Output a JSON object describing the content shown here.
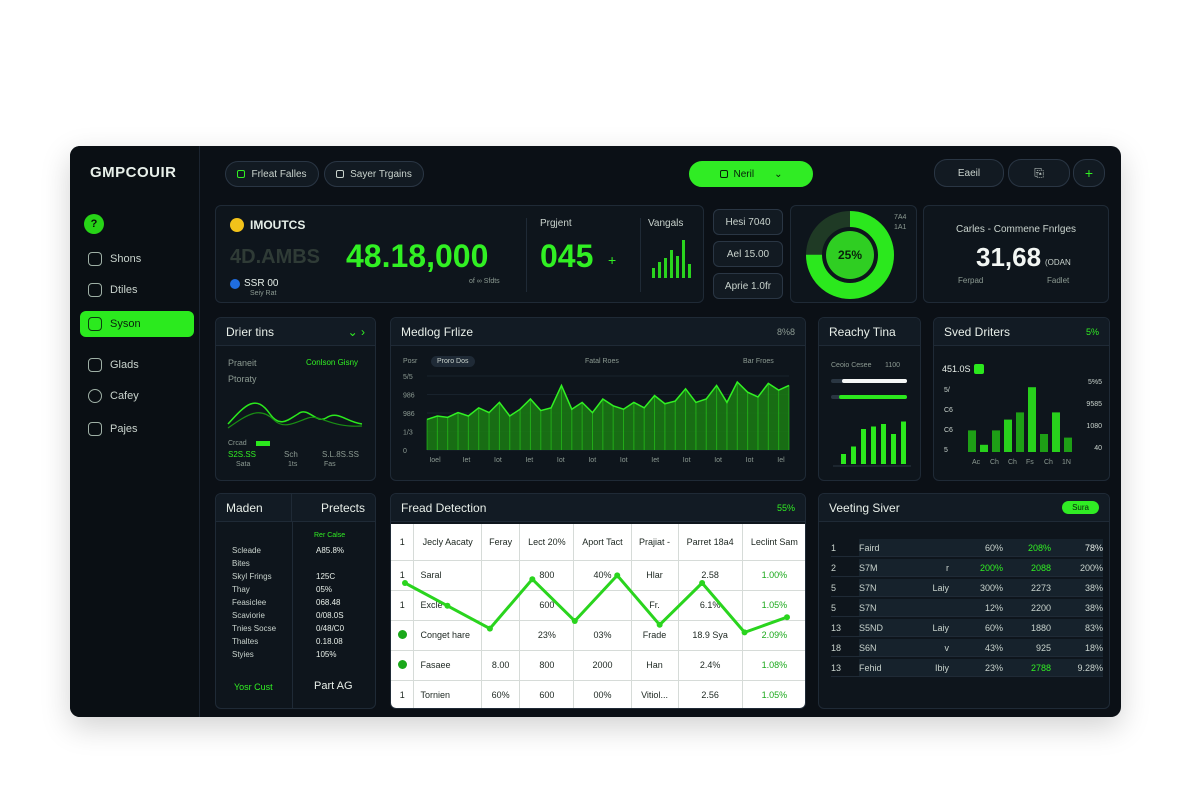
{
  "app": {
    "logo_a": "GMPCOUI",
    "logo_b": "R",
    "logo_badge": "?"
  },
  "sidebar": {
    "items": [
      {
        "label": "Shons",
        "icon": "cloud-icon"
      },
      {
        "label": "Dtiles",
        "icon": "cloud-outline-icon"
      },
      {
        "label": "Syson",
        "icon": "list-icon"
      },
      {
        "label": "Glads",
        "icon": "chart-icon"
      },
      {
        "label": "Cafey",
        "icon": "circle-icon"
      },
      {
        "label": "Pajes",
        "icon": "box-icon"
      }
    ]
  },
  "topbar": {
    "btn1": "Frleat Falles",
    "btn2": "Sayer Trgains",
    "btn3": "Neril",
    "btn4": "Eaeil",
    "btn5_icon": "document-icon",
    "btn6": "+"
  },
  "kpi": {
    "title": "IMOUTCS",
    "ghost": "4D.AMBS",
    "value": "48.18,000",
    "sub_a": "SSR 00",
    "sub_b": "Seiy Rat",
    "sub_c": "of ∞ Sfdts",
    "project_label": "Prgjent",
    "project_value": "045",
    "project_suffix": "+",
    "vang_label": "Vangals"
  },
  "mini_buttons": [
    "Hesi 7040",
    "Ael 15.00",
    "Aprie 1.0fr"
  ],
  "donut": {
    "value_label": "25%",
    "side_a": "7A4",
    "side_b": "1A1",
    "percent": 0.75
  },
  "carles": {
    "title": "Carles - Commene  Fnrlges",
    "value": "31,68",
    "suffix": "(ODAN",
    "sub_a": "Ferpad",
    "sub_b": "Fadlet"
  },
  "drier": {
    "title": "Drier tins",
    "line1": "Praneit",
    "line1_right": "Conlson Gisny",
    "line2": "Ptoraty",
    "legend": "Crcad",
    "stat1": "S2S.SS",
    "stat1_sub": "Sata",
    "stat2": "Sch",
    "stat2_sub": "1ts",
    "stat3": "S.L.8S.SS",
    "stat3_sub": "Fas"
  },
  "medlog": {
    "title": "Medlog Frlize",
    "header_right": "8%8",
    "tag": "Proro Dos",
    "caption1": "Posr",
    "caption2": "Fatal Roes",
    "caption3": "Bar Froes",
    "ytick_labels": [
      "5/5",
      "986",
      "986",
      "1/3",
      "0"
    ],
    "xtick_labels": [
      "Ioel",
      "Iet",
      "Iot",
      "Iet",
      "Iot",
      "Iot",
      "Iot",
      "Iet",
      "Iot",
      "Iot",
      "Iot",
      "Iel"
    ]
  },
  "reachy": {
    "title": "Reachy Tina",
    "row1_left": "Ceoio Cesee",
    "row1_right": "1100",
    "bars_values": [
      20,
      35,
      70,
      75,
      80,
      60,
      85
    ],
    "slider1": 0.85,
    "slider2": 0.9
  },
  "svedd": {
    "title": "Sved Driters",
    "header_right": "5%",
    "highlight": "451.0S",
    "left_ticks": [
      "5/",
      "C6",
      "C6",
      "5"
    ],
    "right_ticks": [
      "5%5",
      "9585",
      "1080",
      "40"
    ],
    "bottom_labels": [
      "Ac",
      "Ch",
      "Ch",
      "Fs",
      "Ch",
      "1N"
    ],
    "bars_values": [
      30,
      10,
      30,
      45,
      55,
      90,
      25,
      55,
      20
    ]
  },
  "maden": {
    "title": "Maden",
    "title2": "Pretects",
    "col2_header": "Rer Calse",
    "rows": [
      {
        "k": "Scleade",
        "v": "A85.8%"
      },
      {
        "k": "Bites",
        "v": ""
      },
      {
        "k": "Skyl Frings",
        "v": "125C"
      },
      {
        "k": "Thay",
        "v": "05%"
      },
      {
        "k": "Feasiclee",
        "v": "068.48"
      },
      {
        "k": "Scaviorie",
        "v": "0/08.0S"
      },
      {
        "k": "Tnies Socse",
        "v": "0/48/C0"
      },
      {
        "k": "Thaltes",
        "v": "0.18.08"
      },
      {
        "k": "Styies",
        "v": "105%"
      }
    ],
    "foot_left": "Yosr Cust",
    "foot_right": "Part AG"
  },
  "fraud": {
    "title": "Fread Detection",
    "header_right": "55%",
    "headers": [
      "1",
      "Jecly Aacaty",
      "Feray",
      "Lect 20%",
      "Aport Tact",
      "Prajiat -",
      "Parret 18a4",
      "Leclint Sam"
    ],
    "rows": [
      [
        "Saral",
        "",
        "800",
        "40%",
        "Hlar",
        "2.58",
        "1.00%"
      ],
      [
        "Excle",
        "",
        "600",
        "",
        "Fr.",
        "6.1%",
        "1.05%"
      ],
      [
        "Conget hare",
        "",
        "23%",
        "03%",
        "Frade",
        "18.9 Sya",
        "2.09%"
      ],
      [
        "Fasaee",
        "8.00",
        "800",
        "2000",
        "Han",
        "2.4%",
        "1.08%"
      ],
      [
        "Tornien",
        "60%",
        "600",
        "00%",
        "Vitiol...",
        "2.56",
        "1.05%"
      ]
    ],
    "row_numbers": [
      "1",
      "1",
      "0",
      "0",
      "1"
    ],
    "line_values": [
      0.75,
      0.45,
      0.15,
      0.8,
      0.25,
      0.85,
      0.2,
      0.75,
      0.1,
      0.3
    ]
  },
  "vesting": {
    "title": "Veeting Siver",
    "badge": "Sura",
    "rows": [
      [
        "1",
        "Faird",
        "",
        "",
        "60%",
        "208%",
        "78%"
      ],
      [
        "2",
        "S7M",
        "r",
        "",
        "200%",
        "2088",
        "200%"
      ],
      [
        "5",
        "S7N",
        "Laiy",
        "",
        "300%",
        "2273",
        "38%"
      ],
      [
        "5",
        "S7N",
        "",
        "",
        "12%",
        "2200",
        "38%"
      ],
      [
        "13",
        "S5ND",
        "Laiy",
        "",
        "60%",
        "1880",
        "83%"
      ],
      [
        "18",
        "S6N",
        "v",
        "",
        "43%",
        "925",
        "18%"
      ],
      [
        "13",
        "Fehid",
        "Ibiy",
        "",
        "23%",
        "2788",
        "9.28%"
      ]
    ]
  },
  "colors": {
    "accent": "#31f023",
    "bg": "#0b1016",
    "card": "#0e151c"
  }
}
